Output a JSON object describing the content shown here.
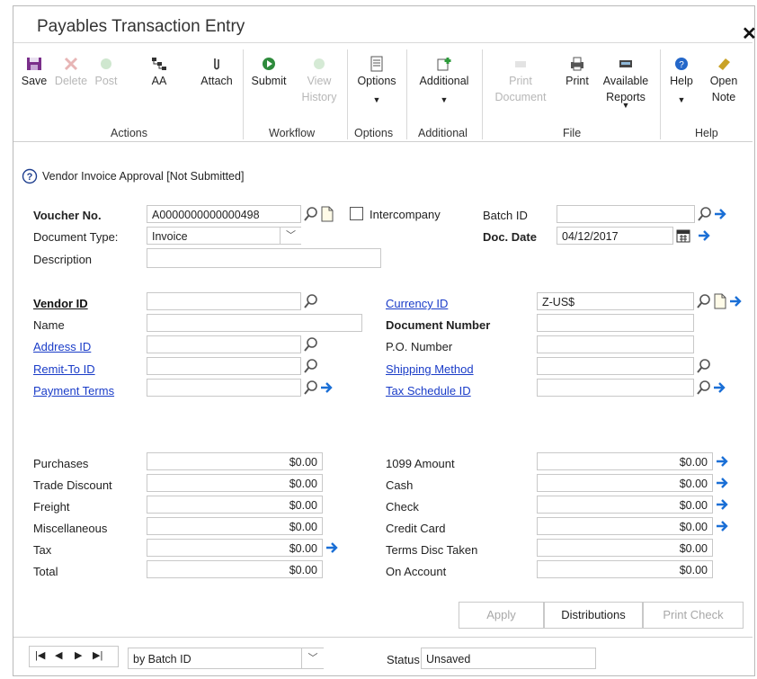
{
  "window": {
    "title": "Payables Transaction Entry"
  },
  "ribbon": {
    "save": "Save",
    "delete": "Delete",
    "post": "Post",
    "aa": "AA",
    "attach": "Attach",
    "submit": "Submit",
    "view_line1": "View",
    "view_line2": "History",
    "options": "Options",
    "additional": "Additional",
    "print_doc_line1": "Print",
    "print_doc_line2": "Document",
    "print": "Print",
    "avail_line1": "Available",
    "avail_line2": "Reports",
    "help": "Help",
    "open_line1": "Open",
    "open_line2": "Note",
    "groups": {
      "actions": "Actions",
      "workflow": "Workflow",
      "options": "Options",
      "additional": "Additional",
      "file": "File",
      "help": "Help"
    }
  },
  "approval_status": "Vendor Invoice Approval [Not Submitted]",
  "header": {
    "voucher_label": "Voucher No.",
    "voucher_value": "A0000000000000498",
    "intercompany_label": "Intercompany",
    "batch_label": "Batch ID",
    "batch_value": "",
    "doctype_label": "Document Type:",
    "doctype_value": "Invoice",
    "docdate_label": "Doc. Date",
    "docdate_value": "04/12/2017",
    "description_label": "Description",
    "description_value": ""
  },
  "vendor": {
    "vendor_id_label": "Vendor ID",
    "vendor_id_value": "",
    "name_label": "Name",
    "name_value": "",
    "address_label": "Address ID",
    "address_value": "",
    "remit_label": "Remit-To ID",
    "remit_value": "",
    "terms_label": "Payment Terms",
    "terms_value": "",
    "currency_label": "Currency ID",
    "currency_value": "Z-US$",
    "docnum_label": "Document Number",
    "docnum_value": "",
    "po_label": "P.O. Number",
    "po_value": "",
    "shipping_label": "Shipping Method",
    "shipping_value": "",
    "taxsched_label": "Tax Schedule ID",
    "taxsched_value": ""
  },
  "amounts_left": [
    {
      "label": "Purchases",
      "value": "$0.00"
    },
    {
      "label": "Trade Discount",
      "value": "$0.00"
    },
    {
      "label": "Freight",
      "value": "$0.00"
    },
    {
      "label": "Miscellaneous",
      "value": "$0.00"
    },
    {
      "label": "Tax",
      "value": "$0.00"
    },
    {
      "label": "Total",
      "value": "$0.00"
    }
  ],
  "amounts_right": [
    {
      "label": "1099 Amount",
      "value": "$0.00"
    },
    {
      "label": "Cash",
      "value": "$0.00"
    },
    {
      "label": "Check",
      "value": "$0.00"
    },
    {
      "label": "Credit Card",
      "value": "$0.00"
    },
    {
      "label": "Terms Disc Taken",
      "value": "$0.00"
    },
    {
      "label": "On Account",
      "value": "$0.00"
    }
  ],
  "buttons": {
    "apply": "Apply",
    "distributions": "Distributions",
    "print_check": "Print Check"
  },
  "footer": {
    "sort_value": "by Batch ID",
    "status_label": "Status",
    "status_value": "Unsaved"
  },
  "colors": {
    "link": "#1a3cc8",
    "arrow": "#1a6fd6",
    "border": "#c8c8c8"
  }
}
